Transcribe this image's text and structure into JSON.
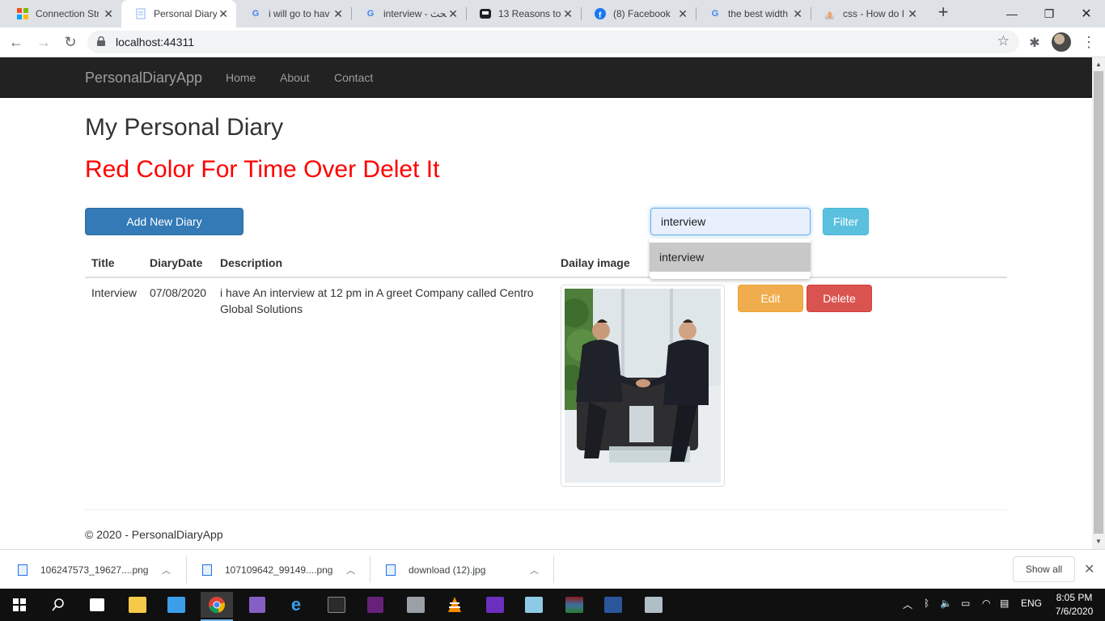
{
  "browser": {
    "tabs": [
      {
        "label": "Connection Str",
        "icon": "windows-icon"
      },
      {
        "label": "Personal Diary",
        "icon": "page-icon"
      },
      {
        "label": "i will go to hav",
        "icon": "google-icon"
      },
      {
        "label": "interview - بحث",
        "icon": "google-icon"
      },
      {
        "label": "13 Reasons to",
        "icon": "media-icon"
      },
      {
        "label": "(8) Facebook",
        "icon": "facebook-icon"
      },
      {
        "label": "the best width",
        "icon": "google-icon"
      },
      {
        "label": "css - How do I",
        "icon": "stackoverflow-icon"
      }
    ],
    "url": "localhost:44311"
  },
  "navbar": {
    "brand": "PersonalDiaryApp",
    "links": [
      "Home",
      "About",
      "Contact"
    ]
  },
  "page": {
    "title": "My Personal Diary",
    "notice": "Red Color For Time Over Delet It",
    "add_button": "Add New Diary",
    "search_value": "interview",
    "filter_button": "Filter",
    "autocomplete_option": "interview"
  },
  "table": {
    "headers": [
      "Title",
      "DiaryDate",
      "Description",
      "Dailay image"
    ],
    "rows": [
      {
        "title": "Interview",
        "date": "07/08/2020",
        "description_line1": "i have An interview at 12 pm in A greet Company called Centro",
        "description_line2": "Global Solutions",
        "edit": "Edit",
        "delete": "Delete"
      }
    ]
  },
  "footer": "© 2020 - PersonalDiaryApp",
  "downloads": {
    "items": [
      "106247573_19627....png",
      "107109642_99149....png",
      "download (12).jpg"
    ],
    "show_all": "Show all"
  },
  "taskbar": {
    "time": "8:05 PM",
    "date": "7/6/2020",
    "language": "ENG"
  },
  "colors": {
    "navbar_bg": "#222222",
    "notice_red": "#ff0000",
    "primary": "#337ab7",
    "info": "#5bc0de",
    "warning": "#f0ad4e",
    "danger": "#d9534f"
  }
}
